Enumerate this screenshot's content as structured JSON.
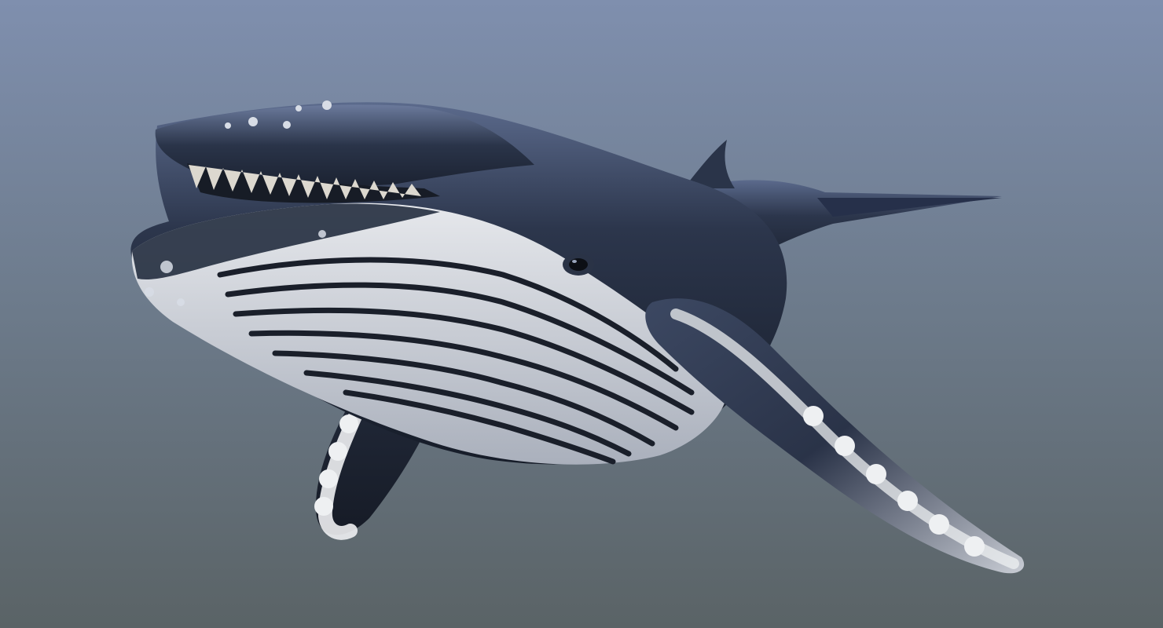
{
  "scene": {
    "subject": "humpback-whale",
    "background": {
      "top_color": "#7f8fae",
      "middle_color": "#6c7a8a",
      "bottom_color": "#5a6366"
    },
    "colors": {
      "body_dark": "#1f2838",
      "body_mid": "#3a4660",
      "body_highlight": "#8c9ab8",
      "belly_light": "#d9dbe0",
      "groove_dark": "#1a1f2a",
      "baleen": "#dcd8cf",
      "fin_white": "#eef0f2"
    }
  }
}
